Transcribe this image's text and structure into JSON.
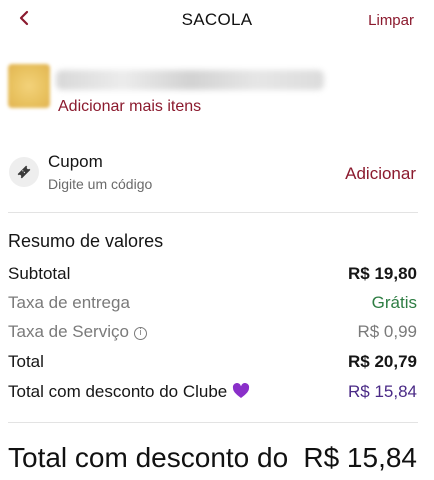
{
  "header": {
    "title": "SACOLA",
    "clear_label": "Limpar"
  },
  "store": {
    "add_more_label": "Adicionar mais itens"
  },
  "coupon": {
    "title": "Cupom",
    "subtitle": "Digite um código",
    "add_label": "Adicionar"
  },
  "summary": {
    "title": "Resumo de valores",
    "rows": [
      {
        "label": "Subtotal",
        "value": "R$ 19,80"
      },
      {
        "label": "Taxa de entrega",
        "value": "Grátis"
      },
      {
        "label": "Taxa de Serviço",
        "value": "R$ 0,99"
      },
      {
        "label": "Total",
        "value": "R$ 20,79"
      },
      {
        "label": "Total com desconto do Clube",
        "value": "R$ 15,84"
      }
    ]
  },
  "footer": {
    "label": "Total com desconto do",
    "value": "R$ 15,84"
  },
  "colors": {
    "accent": "#8b1a2e",
    "free": "#2e7d43",
    "club": "#4a2a86",
    "heart": "#8a2fc9"
  }
}
